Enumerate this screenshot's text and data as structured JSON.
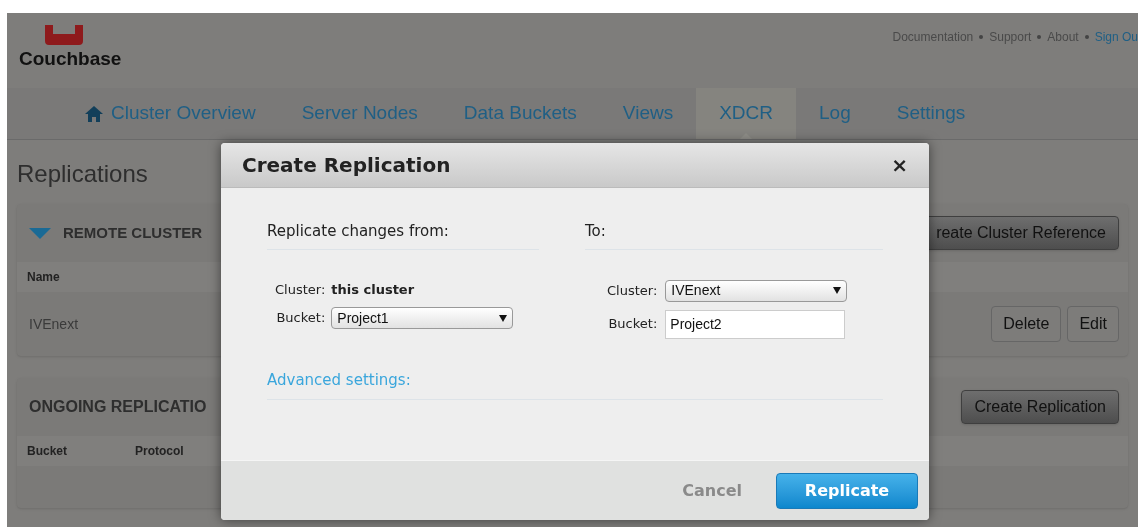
{
  "header": {
    "logo": "Couchbase",
    "links": [
      {
        "label": "Documentation",
        "kind": "plain"
      },
      {
        "label": "Support",
        "kind": "plain"
      },
      {
        "label": "About",
        "kind": "plain"
      },
      {
        "label": "Sign Ou",
        "kind": "accent"
      }
    ]
  },
  "nav": [
    {
      "label": "Cluster Overview",
      "selected": false
    },
    {
      "label": "Server Nodes",
      "selected": false
    },
    {
      "label": "Data Buckets",
      "selected": false
    },
    {
      "label": "Views",
      "selected": false
    },
    {
      "label": "XDCR",
      "selected": true
    },
    {
      "label": "Log",
      "selected": false
    },
    {
      "label": "Settings",
      "selected": false
    }
  ],
  "page_title": "Replications",
  "remote_clusters": {
    "title": "REMOTE CLUSTER",
    "expanded": true,
    "button": "reate Cluster Reference",
    "columns": [
      "Name"
    ],
    "rows": [
      {
        "name": "IVEnext",
        "actions": [
          "Delete",
          "Edit"
        ]
      }
    ]
  },
  "ongoing": {
    "title": "ONGOING REPLICATIO",
    "button": "Create Replication",
    "columns": [
      "Bucket",
      "Protocol"
    ]
  },
  "dialog": {
    "title": "Create Replication",
    "close": "×",
    "from": {
      "heading": "Replicate changes from:",
      "cluster_label": "Cluster:",
      "cluster_value": "this cluster",
      "bucket_label": "Bucket:",
      "bucket_value": "Project1"
    },
    "to": {
      "heading": "To:",
      "cluster_label": "Cluster:",
      "cluster_value": "IVEnext",
      "bucket_label": "Bucket:",
      "bucket_value": "Project2"
    },
    "advanced": "Advanced settings:",
    "cancel": "Cancel",
    "submit": "Replicate"
  }
}
